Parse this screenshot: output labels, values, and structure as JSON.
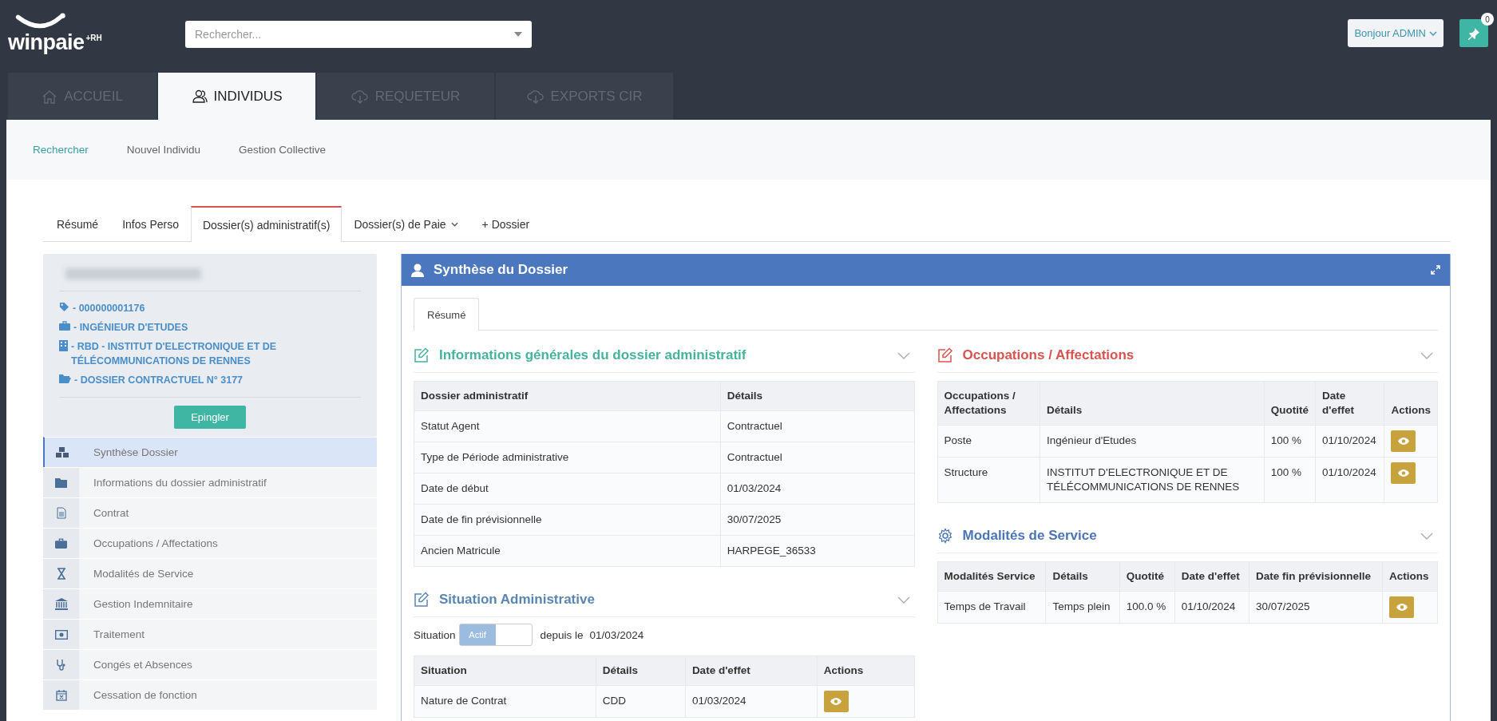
{
  "logo": {
    "name": "winpaie",
    "suffix": "+RH"
  },
  "search": {
    "placeholder": "Rechercher..."
  },
  "user_menu": {
    "label": "Bonjour ADMIN"
  },
  "pin_button": {
    "badge": "0"
  },
  "main_tabs": [
    {
      "label": "ACCUEIL",
      "selected": false
    },
    {
      "label": "INDIVIDUS",
      "selected": true
    },
    {
      "label": "REQUETEUR",
      "selected": false
    },
    {
      "label": "EXPORTS CIR",
      "selected": false
    }
  ],
  "sub_nav": [
    {
      "label": "Rechercher",
      "selected": true
    },
    {
      "label": "Nouvel Individu",
      "selected": false
    },
    {
      "label": "Gestion Collective",
      "selected": false
    }
  ],
  "record_tabs": [
    {
      "label": "Résumé",
      "selected": false,
      "dropdown": false
    },
    {
      "label": "Infos Perso",
      "selected": false,
      "dropdown": false
    },
    {
      "label": "Dossier(s) administratif(s)",
      "selected": true,
      "dropdown": false
    },
    {
      "label": "Dossier(s) de Paie",
      "selected": false,
      "dropdown": true
    },
    {
      "label": "+ Dossier",
      "selected": false,
      "dropdown": false
    }
  ],
  "summary_card": {
    "lines": [
      "- 000000001176",
      "- INGÉNIEUR D'ETUDES",
      "- RBD - INSTITUT D'ELECTRONIQUE ET DE TÉLÉCOMMUNICATIONS DE RENNES",
      "- DOSSIER CONTRACTUEL N° 3177"
    ],
    "button": "Epingler"
  },
  "side_nav": [
    {
      "label": "Synthèse Dossier",
      "selected": true
    },
    {
      "label": "Informations du dossier administratif",
      "selected": false
    },
    {
      "label": "Contrat",
      "selected": false
    },
    {
      "label": "Occupations / Affectations",
      "selected": false
    },
    {
      "label": "Modalités de Service",
      "selected": false
    },
    {
      "label": "Gestion Indemnitaire",
      "selected": false
    },
    {
      "label": "Traitement",
      "selected": false
    },
    {
      "label": "Congés et Absences",
      "selected": false
    },
    {
      "label": "Cessation de fonction",
      "selected": false
    }
  ],
  "panel": {
    "title": "Synthèse du Dossier",
    "tabs": [
      {
        "label": "Résumé",
        "selected": true
      }
    ],
    "columns": [
      [
        {
          "title": "Informations générales du dossier administratif",
          "color": "#45b39d",
          "kind": "edit",
          "table": {
            "columns": [
              "Dossier administratif",
              "Détails"
            ],
            "rows": [
              {
                "cells": [
                  "Statut Agent",
                  "Contractuel"
                ],
                "action": false
              },
              {
                "cells": [
                  "Type de Période administrative",
                  "Contractuel"
                ],
                "action": false
              },
              {
                "cells": [
                  "Date de début",
                  "01/03/2024"
                ],
                "action": false
              },
              {
                "cells": [
                  "Date de fin prévisionnelle",
                  "30/07/2025"
                ],
                "action": false
              },
              {
                "cells": [
                  "Ancien Matricule",
                  "HARPEGE_36533"
                ],
                "action": false
              }
            ]
          }
        },
        {
          "title": "Situation Administrative",
          "color": "#5b86b4",
          "kind": "edit",
          "status": {
            "label": "Situation",
            "toggle": "Actif",
            "on": true,
            "since": "depuis le",
            "date": "01/03/2024"
          },
          "table": {
            "columns": [
              "Situation",
              "Détails",
              "Date d'effet",
              "Actions"
            ],
            "rows": [
              {
                "cells": [
                  "Nature de Contrat",
                  "CDD",
                  "01/03/2024"
                ],
                "action": true
              }
            ]
          }
        }
      ],
      [
        {
          "title": "Occupations / Affectations",
          "color": "#d9534f",
          "kind": "edit",
          "table": {
            "columns": [
              "Occupations / Affectations",
              "Détails",
              "Quotité",
              "Date d'effet",
              "Actions"
            ],
            "rows": [
              {
                "cells": [
                  "Poste",
                  "Ingénieur d'Etudes",
                  "100 %",
                  "01/10/2024"
                ],
                "action": true
              },
              {
                "cells": [
                  "Structure",
                  "INSTITUT D'ELECTRONIQUE ET DE TÉLÉCOMMUNICATIONS DE RENNES",
                  "100 %",
                  "01/10/2024"
                ],
                "action": true
              }
            ]
          }
        },
        {
          "title": "Modalités de Service",
          "color": "#4a76b8",
          "kind": "settings",
          "table": {
            "columns": [
              "Modalités Service",
              "Détails",
              "Quotité",
              "Date d'effet",
              "Date fin prévisionnelle",
              "Actions"
            ],
            "rows": [
              {
                "cells": [
                  "Temps de Travail",
                  "Temps plein",
                  "100.0 %",
                  "01/10/2024",
                  "30/07/2025"
                ],
                "action": true
              }
            ]
          }
        }
      ]
    ]
  }
}
